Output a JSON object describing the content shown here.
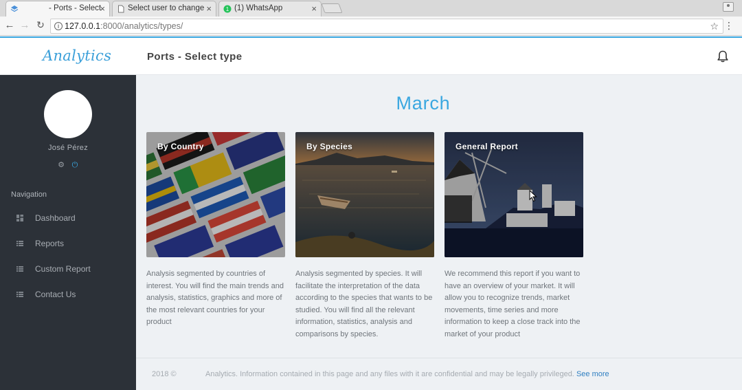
{
  "browser": {
    "tabs": [
      {
        "label": "- Ports - Select",
        "active": true,
        "icon": "layers-icon"
      },
      {
        "label": "Select user to change",
        "active": false,
        "icon": "document-icon"
      },
      {
        "label": "(1) WhatsApp",
        "active": false,
        "icon": "whatsapp-icon"
      }
    ],
    "tab_close": "×",
    "url_host": "127.0.0.1",
    "url_path": ":8000/analytics/types/"
  },
  "header": {
    "brand": "Analytics",
    "page_title": "Ports - Select type"
  },
  "sidebar": {
    "user_name": "José Pérez",
    "nav_heading": "Navigation",
    "items": [
      {
        "label": "Dashboard",
        "icon": "dashboard-icon"
      },
      {
        "label": "Reports",
        "icon": "list-icon"
      },
      {
        "label": "Custom Report",
        "icon": "list-icon"
      },
      {
        "label": "Contact Us",
        "icon": "list-icon"
      }
    ]
  },
  "main": {
    "month": "March",
    "cards": [
      {
        "title": "By Country",
        "description": "Analysis segmented by countries of interest. You will find the main trends and analysis, statistics, graphics and more of the most relevant countries for your product"
      },
      {
        "title": "By Species",
        "description": "Analysis segmented by species. It will facilitate the interpretation of the data according to the species that wants to be studied. You will find all the relevant information, statistics, analysis and comparisons by species."
      },
      {
        "title": "General Report",
        "description": "We recommend this report if you want to have an overview of your market. It will allow you to recognize trends, market movements, time series and more information to keep a close track into the market of your product"
      }
    ]
  },
  "footer": {
    "year": "2018 ©",
    "text": "Analytics. Information contained in this page and any files with it are confidential and may be legally privileged.",
    "link": "See more"
  },
  "colors": {
    "accent": "#3aa7e0",
    "sidebar_bg": "#2c3138",
    "content_bg": "#eef1f4"
  }
}
